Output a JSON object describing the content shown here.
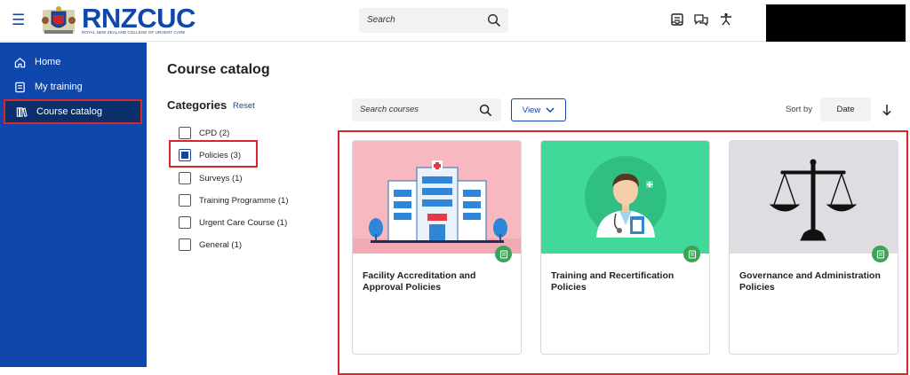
{
  "header": {
    "logo_text": "RNZCUC",
    "logo_subtext": "ROYAL NEW ZEALAND COLLEGE OF URGENT CARE",
    "search_placeholder": "Search",
    "icons": [
      "menu-icon",
      "search-icon",
      "message-drawer-icon",
      "chat-icon",
      "accessibility-icon"
    ]
  },
  "sidebar": {
    "items": [
      {
        "label": "Home",
        "icon": "home-icon"
      },
      {
        "label": "My training",
        "icon": "my-training-icon"
      },
      {
        "label": "Course catalog",
        "icon": "library-icon",
        "active": true
      }
    ]
  },
  "main": {
    "title": "Course catalog",
    "categories_title": "Categories",
    "reset_label": "Reset",
    "categories": [
      {
        "label": "CPD (2)",
        "checked": false
      },
      {
        "label": "Policies (3)",
        "checked": true
      },
      {
        "label": "Surveys (1)",
        "checked": false
      },
      {
        "label": "Training Programme (1)",
        "checked": false
      },
      {
        "label": "Urgent Care Course (1)",
        "checked": false
      },
      {
        "label": "General (1)",
        "checked": false
      }
    ],
    "search_courses_placeholder": "Search courses",
    "view_label": "View",
    "sort_by_label": "Sort by",
    "sort_value": "Date",
    "courses": [
      {
        "title": "Facility Accreditation and Approval Policies",
        "image": "hospital-building-illustration"
      },
      {
        "title": "Training and Recertification Policies",
        "image": "doctor-illustration"
      },
      {
        "title": "Governance and Administration Policies",
        "image": "scales-of-justice-illustration"
      }
    ]
  },
  "colors": {
    "brand_blue": "#0f47ad",
    "sidebar_active": "#0b2f6b",
    "highlight_red": "#d9262c",
    "badge_green": "#3aa655",
    "card1_bg": "#f7b8c0",
    "card2_bg": "#41d99a",
    "card3_bg": "#dedee2"
  }
}
